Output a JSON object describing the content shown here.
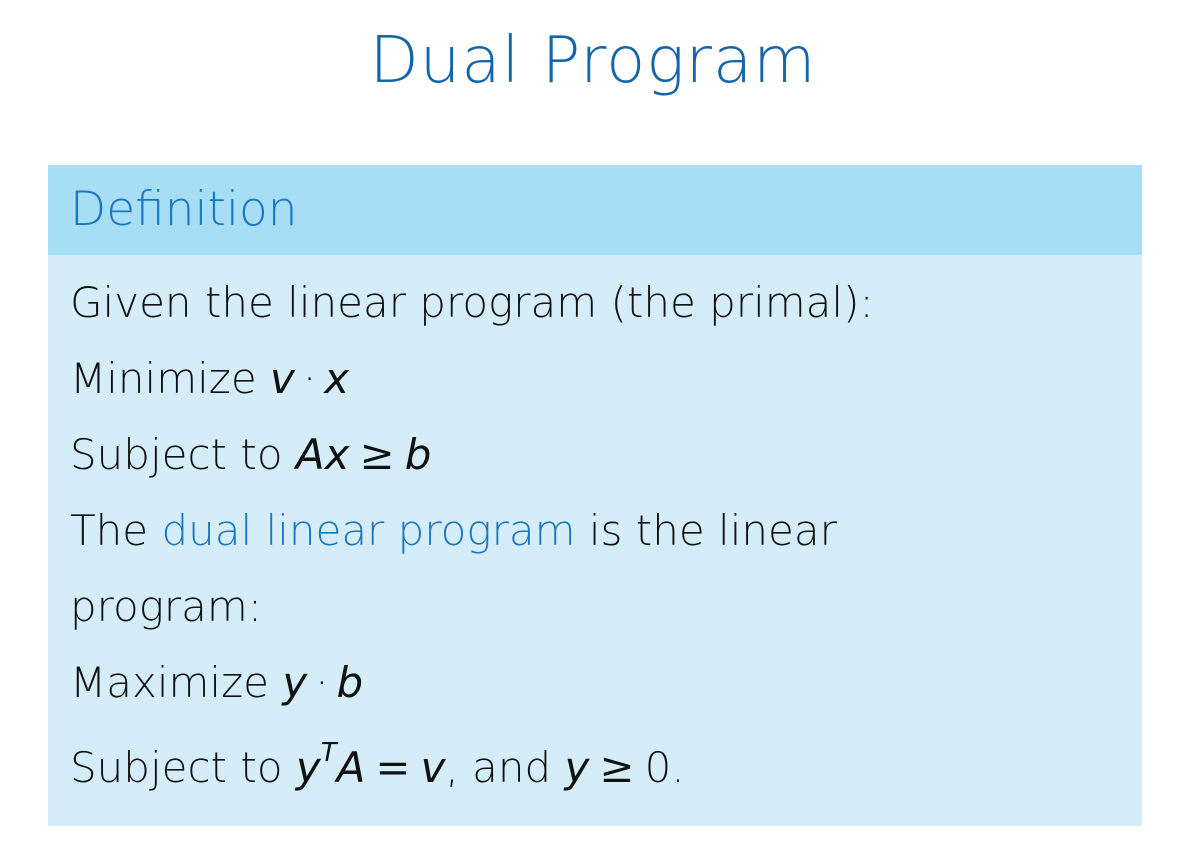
{
  "title": "Dual Program",
  "definition": {
    "heading": "Definition",
    "line1": "Given the linear program (the primal):",
    "line2_prefix": "Minimize",
    "line2_var1": "v",
    "line2_op": "·",
    "line2_var2": "x",
    "line3_prefix": "Subject to",
    "line3_lhs": "Ax",
    "line3_op": "≥",
    "line3_rhs": "b",
    "line4_prefix": "The",
    "line4_term": "dual linear program",
    "line4_suffix": "is the linear",
    "line5": "program:",
    "line6_prefix": "Maximize",
    "line6_var1": "y",
    "line6_op": "·",
    "line6_var2": "b",
    "line7_prefix": "Subject to",
    "line7_y": "y",
    "line7_sup": "T",
    "line7_A": "A",
    "line7_eq": "=",
    "line7_v": "v",
    "line7_and": ", and",
    "line7_y2": "y",
    "line7_geq": "≥",
    "line7_zero": "0."
  }
}
